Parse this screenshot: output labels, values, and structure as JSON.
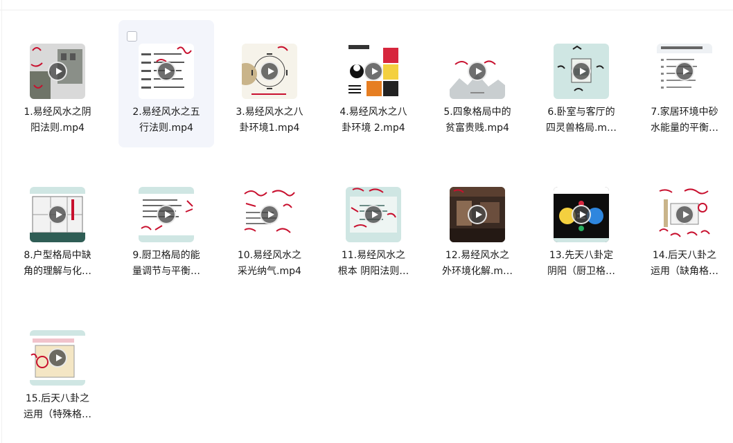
{
  "files": [
    {
      "name": "1.易经风水之阴\n阳法则.mp4",
      "thumb": "photo-gray",
      "selected": false
    },
    {
      "name": "2.易经风水之五\n行法则.mp4",
      "thumb": "text-doc",
      "selected": true
    },
    {
      "name": "3.易经风水之八\n卦环境1.mp4",
      "thumb": "bagua-circle",
      "selected": false
    },
    {
      "name": "4.易经风水之八\n卦环境 2.mp4",
      "thumb": "bagua-color",
      "selected": false
    },
    {
      "name": "5.四象格局中的\n贫富贵贱.mp4",
      "thumb": "landscape",
      "selected": false
    },
    {
      "name": "6.卧室与客厅的\n四灵兽格局.m…",
      "thumb": "teal-room",
      "selected": false
    },
    {
      "name": "7.家居环境中砂\n水能量的平衡…",
      "thumb": "list-doc",
      "selected": false
    },
    {
      "name": "8.户型格局中缺\n角的理解与化…",
      "thumb": "floorplan",
      "selected": false
    },
    {
      "name": "9.厨卫格局的能\n量调节与平衡…",
      "thumb": "teal-text",
      "selected": false
    },
    {
      "name": "10.易经风水之\n采光纳气.mp4",
      "thumb": "red-writing",
      "selected": false
    },
    {
      "name": "11.易经风水之\n根本 阴阳法则…",
      "thumb": "teal-red",
      "selected": false
    },
    {
      "name": "12.易经风水之\n外环境化解.m…",
      "thumb": "dark-room",
      "selected": false
    },
    {
      "name": "13.先天八卦定\n阴阳（厨卫格…",
      "thumb": "black-bagua",
      "selected": false
    },
    {
      "name": "14.后天八卦之\n运用（缺角格…",
      "thumb": "red-chart",
      "selected": false
    },
    {
      "name": "15.后天八卦之\n运用（特殊格…",
      "thumb": "map-red",
      "selected": false
    }
  ],
  "colors": {
    "accent": "#c8102e",
    "teal": "#cfe6e3",
    "selected_bg": "#f3f5fb"
  }
}
